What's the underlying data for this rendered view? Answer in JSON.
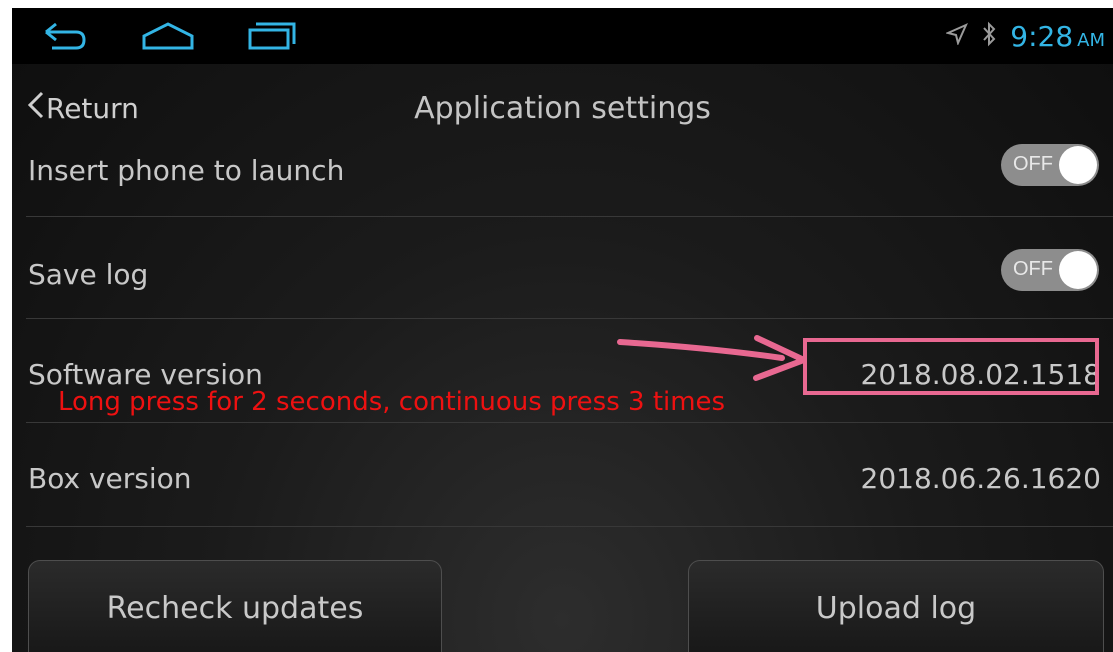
{
  "status_bar": {
    "time": "9:28",
    "ampm": "AM",
    "icons": [
      "back-icon",
      "home-icon",
      "recent-apps-icon",
      "location-icon",
      "bluetooth-icon"
    ],
    "accent_color": "#33b5e5"
  },
  "header": {
    "back_label": "Return",
    "title": "Application settings"
  },
  "settings": {
    "insert_phone": {
      "label": "Insert phone to launch",
      "toggle": "OFF"
    },
    "save_log": {
      "label": "Save log",
      "toggle": "OFF"
    },
    "software_version": {
      "label": "Software version",
      "value": "2018.08.02.1518"
    },
    "box_version": {
      "label": "Box version",
      "value": "2018.06.26.1620"
    }
  },
  "annotation": {
    "text": "Long press for 2 seconds, continuous press 3 times",
    "color": "#ee1111",
    "highlight_color": "#e86891"
  },
  "buttons": {
    "recheck": "Recheck updates",
    "upload": "Upload log"
  }
}
